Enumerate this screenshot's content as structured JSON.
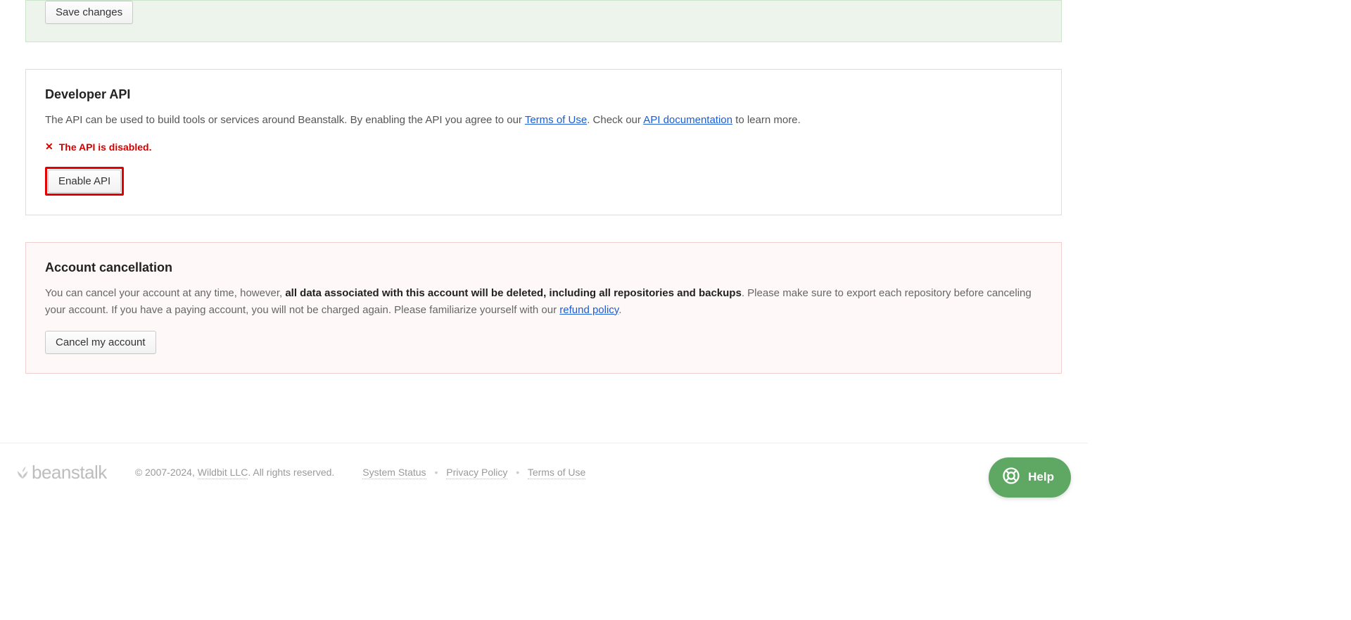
{
  "save_panel": {
    "save_button": "Save changes"
  },
  "api_panel": {
    "title": "Developer API",
    "desc_before": "The API can be used to build tools or services around Beanstalk. By enabling the API you agree to our ",
    "terms_link": "Terms of Use",
    "desc_mid": ". Check our ",
    "doc_link": "API documentation",
    "desc_after": " to learn more.",
    "disabled_msg": "The API is disabled.",
    "enable_button": "Enable API"
  },
  "cancel_panel": {
    "title": "Account cancellation",
    "p1a": "You can cancel your account at any time, however, ",
    "p1b": "all data associated with this account will be deleted, including all repositories and backups",
    "p1c": ". Please make sure to export each repository before canceling your account. If you have a paying account, you will not be charged again. Please familiarize yourself with our ",
    "refund_link": "refund policy",
    "p1d": ".",
    "cancel_button": "Cancel my account"
  },
  "footer": {
    "logo_text": "beanstalk",
    "copyright_a": "© 2007-2024, ",
    "wildbit": "Wildbit LLC",
    "copyright_b": ". All rights reserved.",
    "links": {
      "status": "System Status",
      "privacy": "Privacy Policy",
      "terms": "Terms of Use"
    }
  },
  "help": {
    "label": "Help"
  }
}
